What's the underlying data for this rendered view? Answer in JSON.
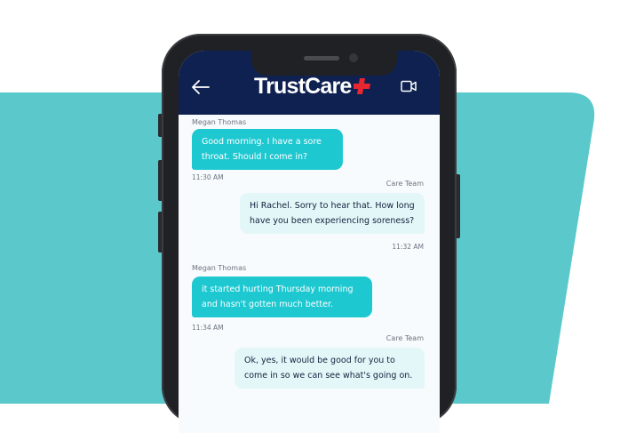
{
  "colors": {
    "teal_background": "#5bc8cc",
    "header": "#0f2150",
    "incoming_bubble": "#1ec8d1",
    "outgoing_bubble": "#e3f7f8",
    "brand_plus": "#e8262f"
  },
  "header": {
    "back_icon": "back-arrow-icon",
    "brand": "TrustCare",
    "logo_icon": "red-plus-icon",
    "video_icon": "video-camera-icon"
  },
  "messages": [
    {
      "sender": "Megan Thomas",
      "text": "Good morning. I have a sore\nthroat. Should I come in?",
      "time": "11:30 AM",
      "direction": "incoming"
    },
    {
      "sender": "Care Team",
      "text": "Hi Rachel. Sorry to hear that. How long\nhave you been experiencing soreness?",
      "time": "11:32 AM",
      "direction": "outgoing"
    },
    {
      "sender": "Megan Thomas",
      "text": "it started hurting Thursday morning\nand hasn't gotten much better.",
      "time": "11:34 AM",
      "direction": "incoming"
    },
    {
      "sender": "Care Team",
      "text": "Ok, yes, it would be good for you to\ncome in so we can see what's going on.",
      "time": "",
      "direction": "outgoing"
    }
  ]
}
